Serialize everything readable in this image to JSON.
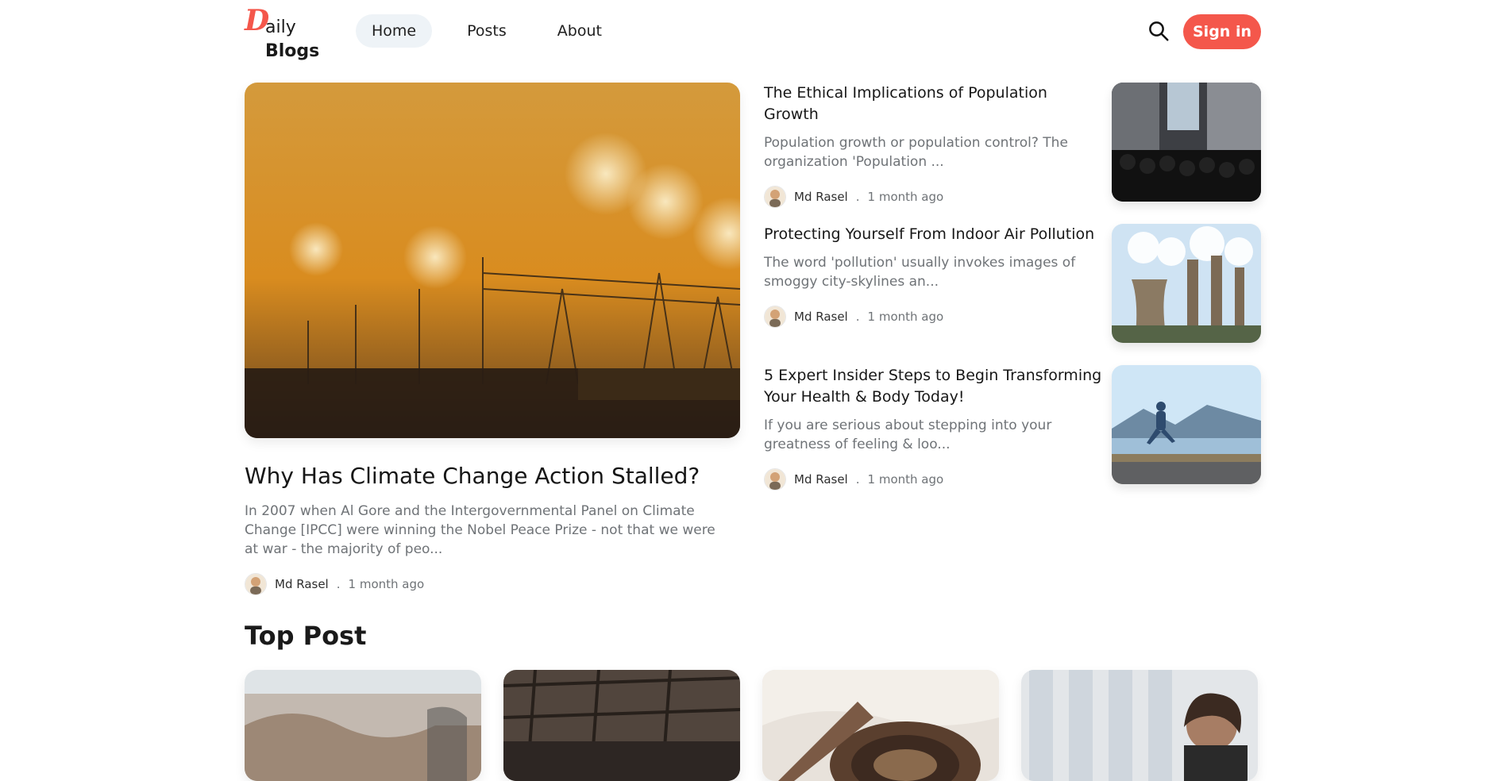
{
  "header": {
    "logo": {
      "d": "D",
      "aily": "aily",
      "blogs": "Blogs"
    },
    "nav": [
      {
        "label": "Home",
        "active": true
      },
      {
        "label": "Posts",
        "active": false
      },
      {
        "label": "About",
        "active": false
      }
    ],
    "search_icon": "search-icon",
    "sign_in": "Sign in",
    "accent": "#f4574b"
  },
  "featured": {
    "title": "Why Has Climate Change Action Stalled?",
    "excerpt": "In 2007 when Al Gore and the Intergovernmental Panel on Climate Change [IPCC] were winning the Nobel Peace Prize - not that we were at war - the majority of peo...",
    "author": "Md Rasel",
    "separator": ".",
    "time": "1 month ago"
  },
  "side": [
    {
      "title": "The Ethical Implications of Population Growth",
      "excerpt": "Population growth or population control? The organization 'Population ...",
      "author": "Md Rasel",
      "separator": ".",
      "time": "1 month ago"
    },
    {
      "title": "Protecting Yourself From Indoor Air Pollution",
      "excerpt": "The word 'pollution' usually invokes images of smoggy city-skylines an...",
      "author": "Md Rasel",
      "separator": ".",
      "time": "1 month ago"
    },
    {
      "title": "5 Expert Insider Steps to Begin Transforming Your Health & Body Today!",
      "excerpt": "If you are serious about stepping into your greatness of feeling & loo...",
      "author": "Md Rasel",
      "separator": ".",
      "time": "1 month ago"
    }
  ],
  "section": {
    "title": "Top Post"
  }
}
